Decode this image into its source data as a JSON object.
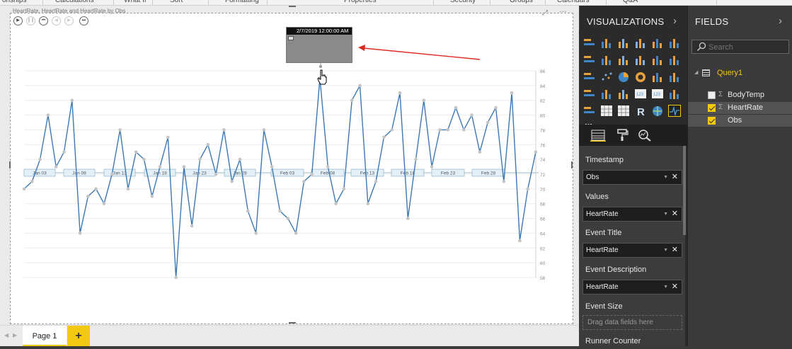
{
  "ribbon": {
    "sections": [
      "onships",
      "Calculations",
      "What If",
      "Sort",
      "Formatting",
      "Properties",
      "Security",
      "Groups",
      "Calendars",
      "Q&A"
    ]
  },
  "visual": {
    "title": "HeartRate, HeartRate and HeartRate by Obs"
  },
  "popup": {
    "timestamp": "2/7/2019 12:00:00 AM"
  },
  "pages": {
    "tab_label": "Page 1",
    "add_label": "+"
  },
  "visualizations": {
    "title": "VISUALIZATIONS",
    "more_label": "...",
    "wells": {
      "timestamp_label": "Timestamp",
      "timestamp_value": "Obs",
      "values_label": "Values",
      "values_value": "HeartRate",
      "event_title_label": "Event Title",
      "event_title_value": "HeartRate",
      "event_desc_label": "Event Description",
      "event_desc_value": "HeartRate",
      "event_size_label": "Event Size",
      "event_size_placeholder": "Drag data fields here",
      "runner_label": "Runner Counter"
    }
  },
  "fields": {
    "title": "FIELDS",
    "search_placeholder": "Search",
    "table_name": "Query1",
    "items": [
      {
        "name": "BodyTemp",
        "checked": false,
        "sigma": true
      },
      {
        "name": "HeartRate",
        "checked": true,
        "sigma": true
      },
      {
        "name": "Obs",
        "checked": true,
        "sigma": false
      }
    ]
  },
  "colors": {
    "line": "#3c78b4",
    "accent": "#f2c811",
    "dark_pane": "#2b2b2b"
  },
  "chart_data": {
    "type": "line",
    "title": "HeartRate, HeartRate and HeartRate by Obs",
    "x": [
      1,
      2,
      3,
      4,
      5,
      6,
      7,
      8,
      9,
      10,
      11,
      12,
      13,
      14,
      15,
      16,
      17,
      18,
      19,
      20,
      21,
      22,
      23,
      24,
      25,
      26,
      27,
      28,
      29,
      30,
      31,
      32,
      33,
      34,
      35,
      36,
      37,
      38,
      39,
      40,
      41,
      42,
      43,
      44,
      45,
      46,
      47,
      48,
      49,
      50,
      51,
      52,
      53,
      54,
      55,
      56,
      57,
      58,
      59,
      60,
      61,
      62,
      63,
      64,
      65,
      66,
      67,
      68,
      69,
      70,
      71,
      72,
      73,
      74,
      75,
      76,
      77,
      78,
      79
    ],
    "series": [
      {
        "name": "HeartRate",
        "values": [
          70,
          71,
          74,
          80,
          73,
          75,
          82,
          64,
          69,
          70,
          68,
          72,
          78,
          70,
          75,
          74,
          69,
          73,
          77,
          58,
          73,
          65,
          74,
          76,
          72,
          78,
          71,
          74,
          67,
          64,
          78,
          73,
          67,
          66,
          64,
          71,
          72,
          85,
          73,
          68,
          70,
          82,
          84,
          68,
          71,
          77,
          78,
          83,
          66,
          74,
          82,
          73,
          78,
          78,
          81,
          78,
          80,
          75,
          79,
          81,
          71,
          83,
          63,
          70,
          75
        ]
      }
    ],
    "y_ticks": [
      86,
      84,
      82,
      80,
      78,
      76,
      74,
      72,
      70,
      68,
      66,
      64,
      62,
      60,
      58
    ],
    "ylim": [
      57,
      87
    ],
    "timeline_labels": [
      "Jan 03",
      "Jan 08",
      "Jan 13",
      "Jan 18",
      "Jan 23",
      "Jan 28",
      "Feb 03",
      "Feb 08",
      "Feb 13",
      "Feb 18",
      "Feb 23",
      "Feb 28"
    ],
    "grid": true
  }
}
